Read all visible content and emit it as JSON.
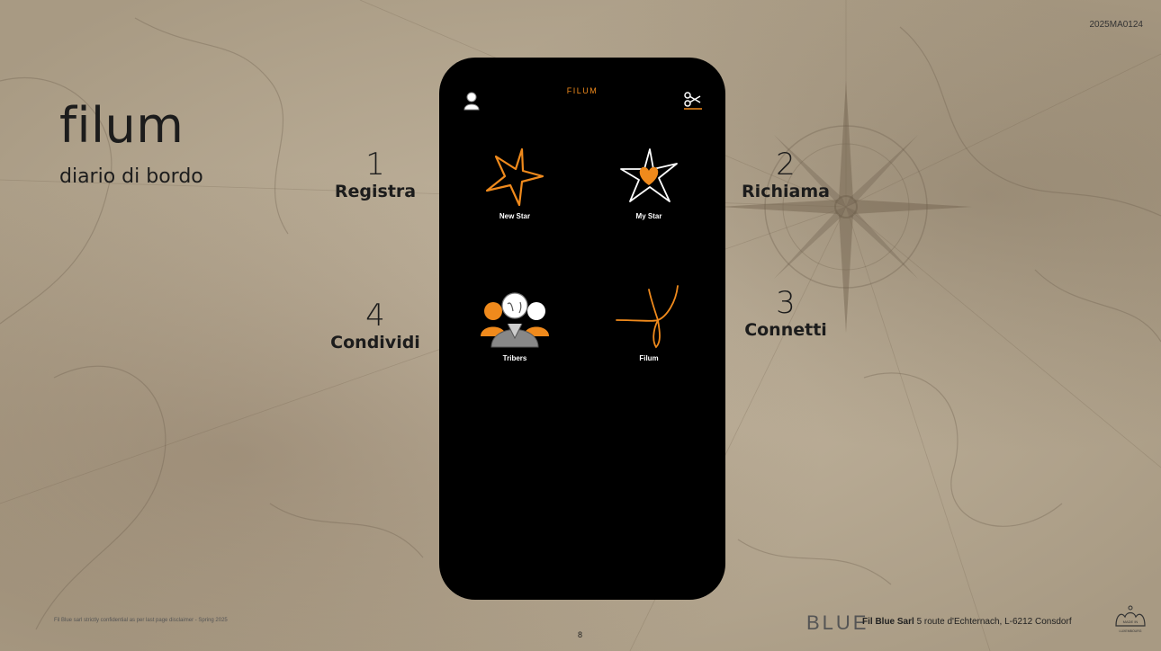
{
  "slide": {
    "reference": "2025MA0124",
    "brand": "filum",
    "subtitle": "diario di bordo",
    "page_number": "8",
    "footer_note": "Fil Blue sarl strictly confidential as per last page disclaimer - Spring 2025"
  },
  "steps": [
    {
      "num": "1",
      "label": "Registra"
    },
    {
      "num": "2",
      "label": "Richiama"
    },
    {
      "num": "3",
      "label": "Connetti"
    },
    {
      "num": "4",
      "label": "Condividi"
    }
  ],
  "phone": {
    "app_title": "FILUM",
    "left_icon": "user-icon",
    "right_icon": "scissors-icon",
    "tiles": [
      {
        "label": "New Star",
        "icon": "star-outline-icon"
      },
      {
        "label": "My Star",
        "icon": "star-heart-icon"
      },
      {
        "label": "Tribers",
        "icon": "people-group-icon"
      },
      {
        "label": "Filum",
        "icon": "thread-icon"
      }
    ],
    "accent": "#f08a1c"
  },
  "footer": {
    "logo": "BLUE",
    "company_name": "Fil Blue Sarl",
    "company_address": "5 route d'Echternach, L-6212 Consdorf",
    "made_in": "MADE IN LUXEMBOURG"
  }
}
